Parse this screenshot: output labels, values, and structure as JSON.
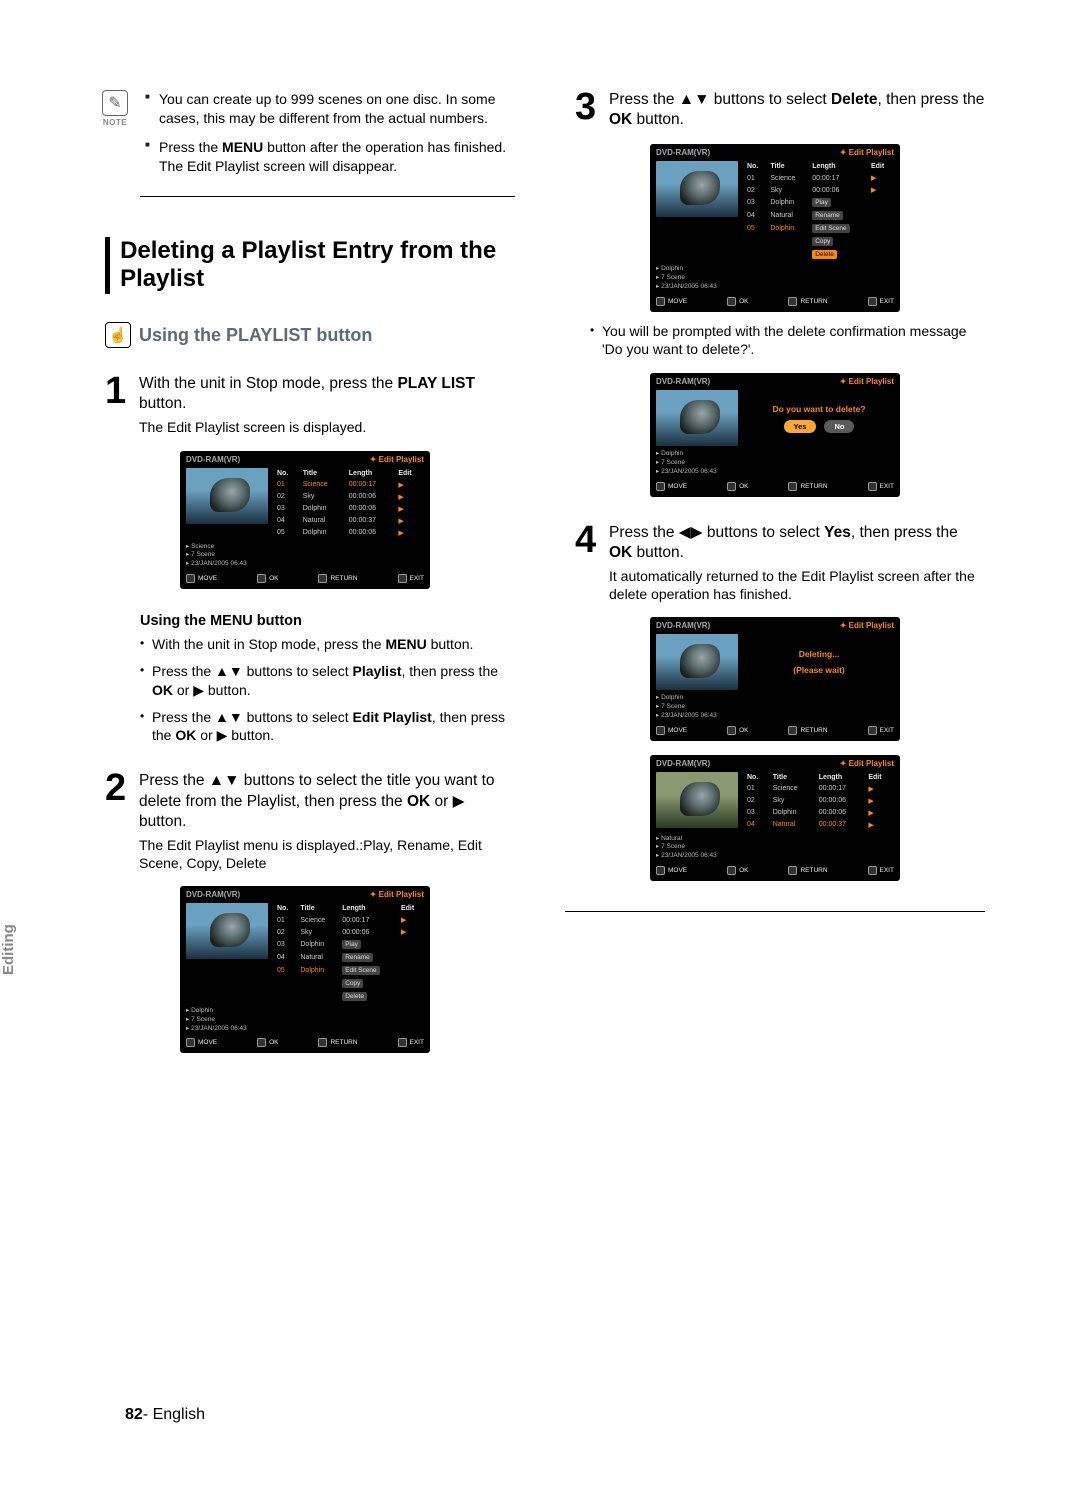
{
  "side_tab": "Editing",
  "footer": {
    "page": "82",
    "sep": "-",
    "lang": "English"
  },
  "note_label": "NOTE",
  "notes": [
    "You can create up to 999 scenes on one disc. In some cases, this may be different from the actual numbers.",
    "Press the MENU button after the operation has finished. The Edit Playlist screen will disappear."
  ],
  "section_title": "Deleting a Playlist Entry from the Playlist",
  "subsection_title": "Using the PLAYLIST button",
  "steps": {
    "1": {
      "num": "1",
      "body_1": "With the unit in Stop mode, press the ",
      "body_b": "PLAY LIST",
      "body_2": " button.",
      "desc": "The Edit Playlist screen is displayed."
    },
    "2": {
      "num": "2",
      "body_1": "Press the ▲▼ buttons to select the title you want to delete from the Playlist, then press the ",
      "body_b1": "OK",
      "body_mid": " or ▶ button.",
      "desc": "The Edit Playlist menu is displayed.:Play, Rename, Edit Scene, Copy, Delete"
    },
    "3": {
      "num": "3",
      "body_1": "Press the ▲▼ buttons to select ",
      "body_b": "Delete",
      "body_2": ", then press the ",
      "body_b2": "OK",
      "body_3": " button."
    },
    "4": {
      "num": "4",
      "body_1": "Press the ◀▶ buttons to select ",
      "body_b": "Yes",
      "body_2": ", then press the ",
      "body_b2": "OK",
      "body_3": " button.",
      "desc": "It automatically returned to the Edit Playlist screen after the delete operation has finished."
    }
  },
  "menu_heading": "Using the MENU button",
  "menu_bullets": {
    "0": "With the unit in Stop mode, press the MENU button.",
    "1": "Press the ▲▼ buttons to select Playlist, then press the OK or ▶ button.",
    "2": "Press the ▲▼ buttons to select Edit Playlist, then press the OK or ▶ button."
  },
  "confirm_bullet": "You will be prompted with the delete confirmation message 'Do you want to delete?'.",
  "osd": {
    "dvd": "DVD-RAM(VR)",
    "edit": "Edit Playlist",
    "cols": {
      "no": "No.",
      "title": "Title",
      "length": "Length",
      "edit": "Edit"
    },
    "rows": [
      {
        "no": "01",
        "title": "Science",
        "len": "00:00:17"
      },
      {
        "no": "02",
        "title": "Sky",
        "len": "00:00:06"
      },
      {
        "no": "03",
        "title": "Dolphin",
        "len": "00:00:06"
      },
      {
        "no": "04",
        "title": "Natural",
        "len": "00:00:37"
      },
      {
        "no": "05",
        "title": "Dolphin",
        "len": "00:00:06"
      }
    ],
    "actions": {
      "play": "Play",
      "rename": "Rename",
      "editscene": "Edit Scene",
      "copy": "Copy",
      "delete": "Delete"
    },
    "info_name_science": "Science",
    "info_name_dolphin": "Dolphin",
    "info_name_natural": "Natural",
    "info_scene": "7 Scene",
    "info_date": "23/JAN/2005 06:43",
    "bar": {
      "move": "MOVE",
      "ok": "OK",
      "return": "RETURN",
      "exit": "EXIT"
    },
    "dlg": {
      "q": "Do you want to delete?",
      "yes": "Yes",
      "no": "No",
      "deleting": "Deleting...",
      "wait": "(Please wait)"
    }
  }
}
